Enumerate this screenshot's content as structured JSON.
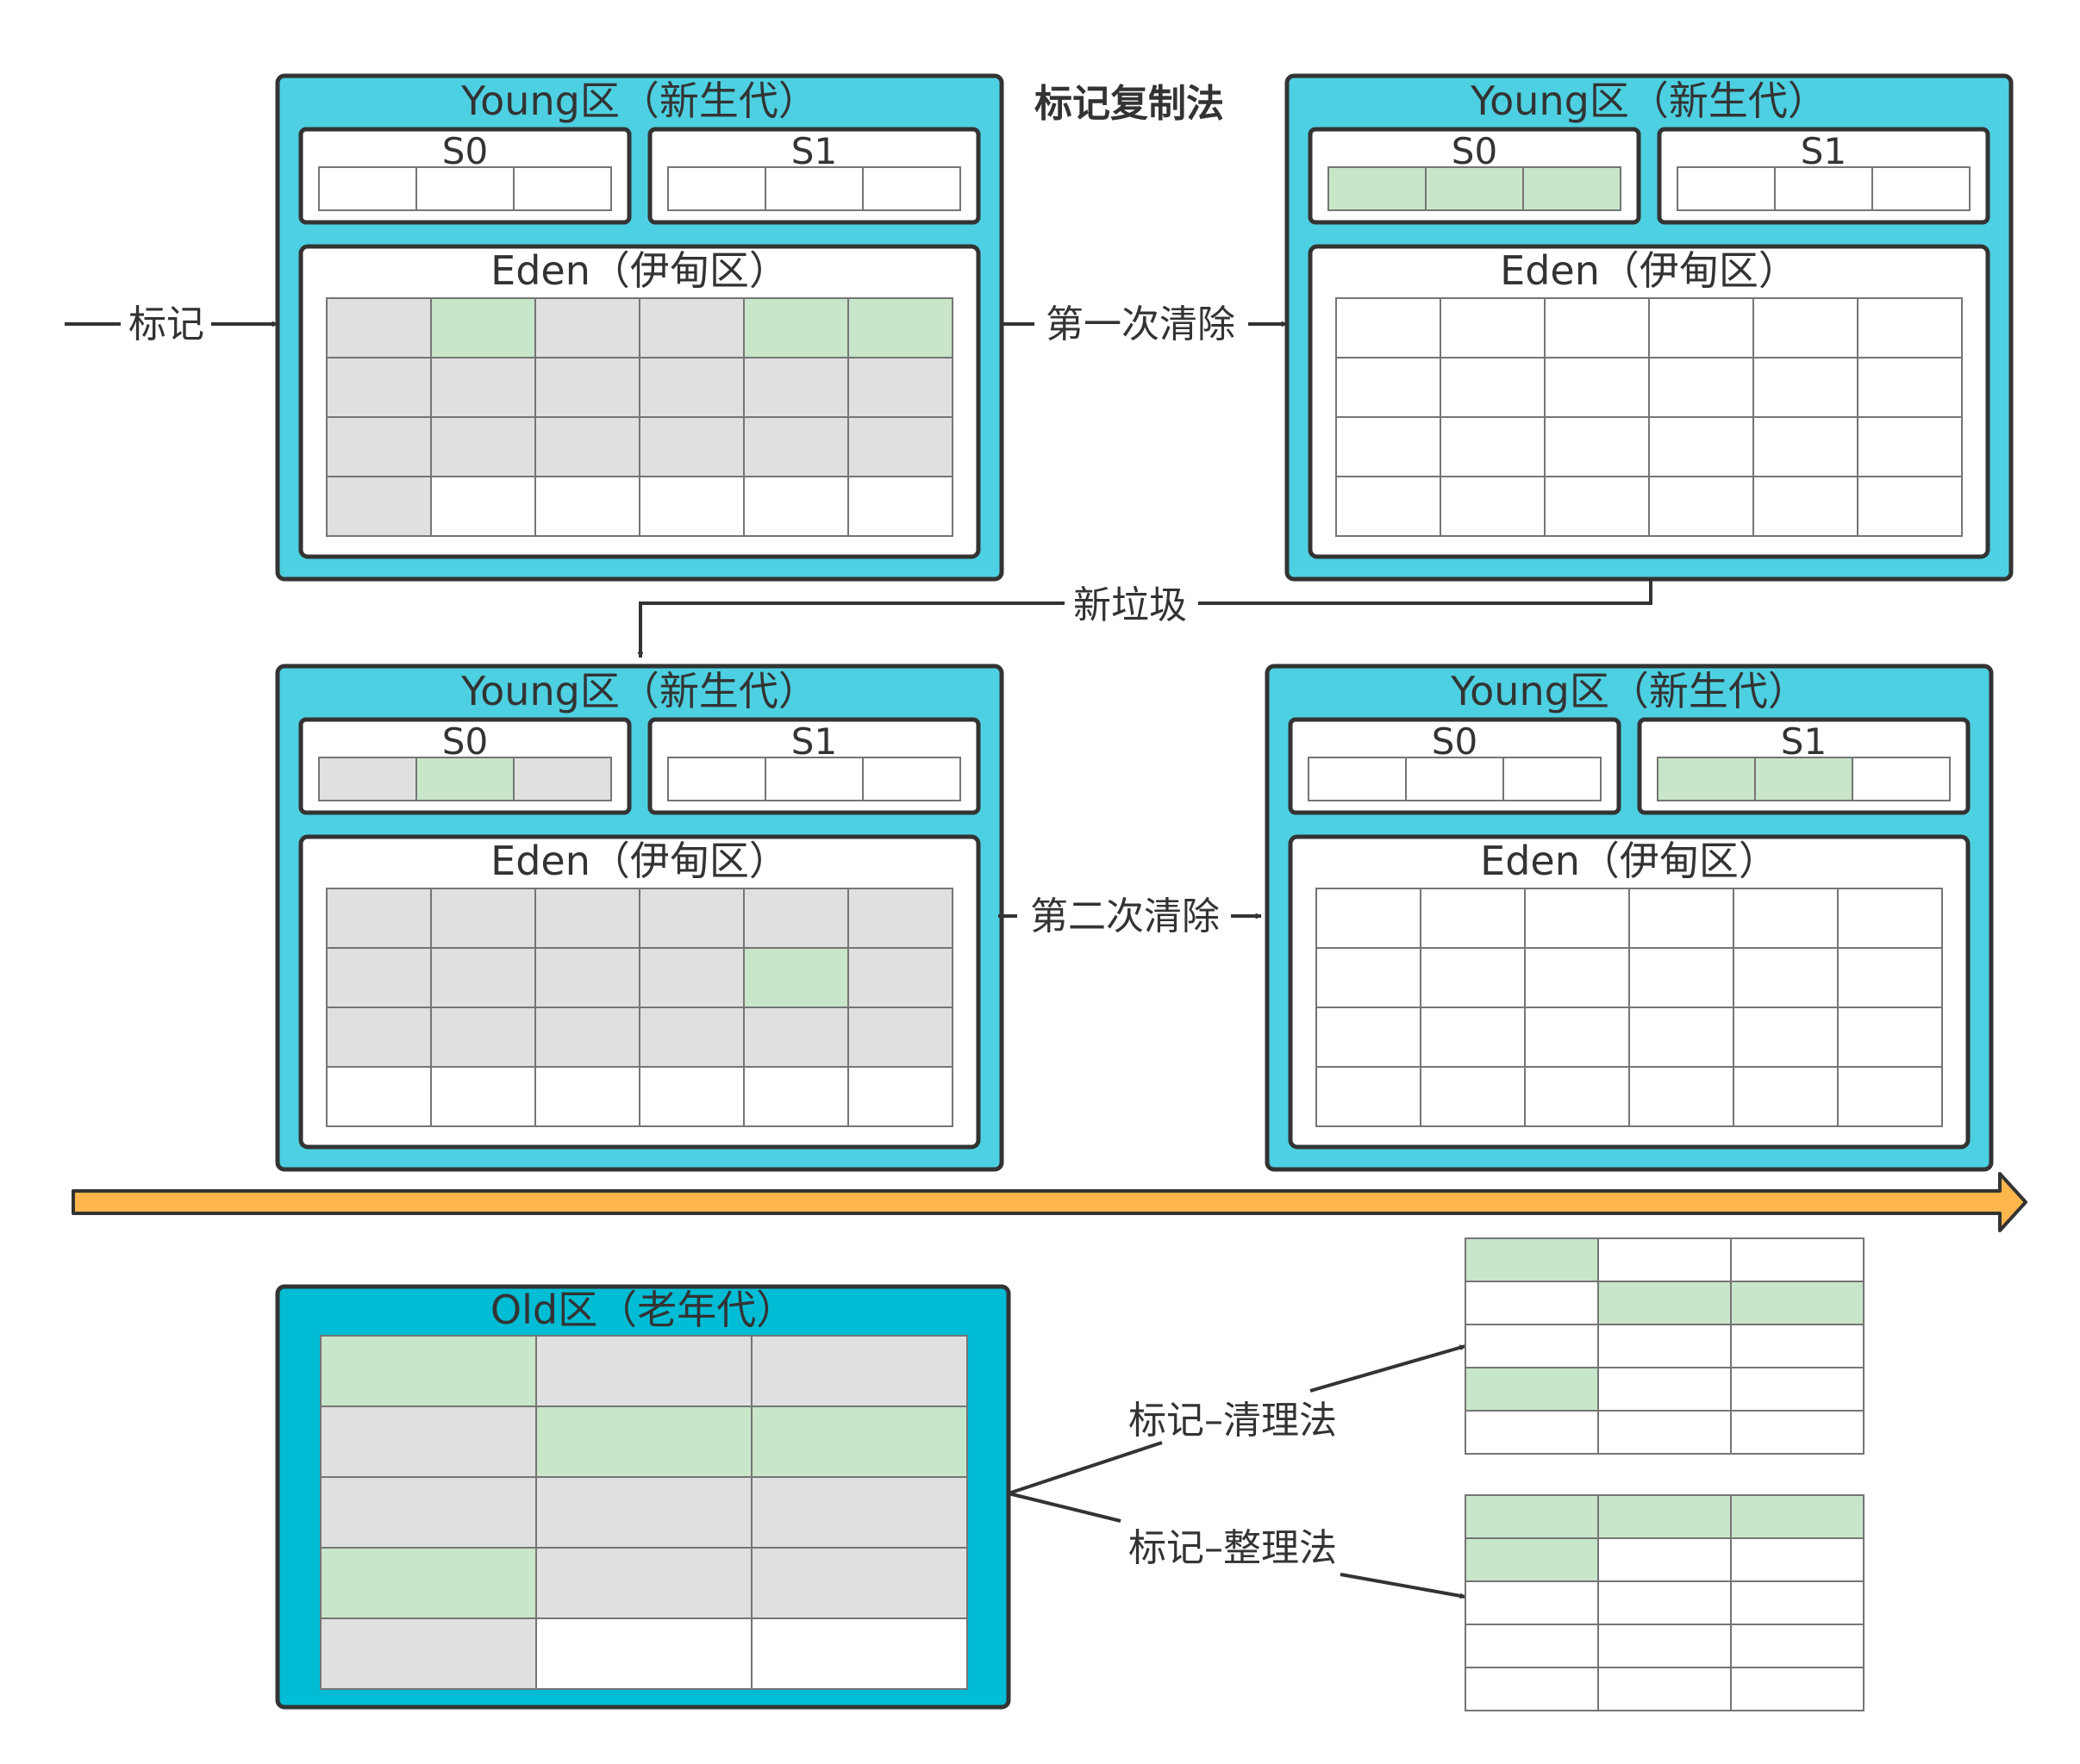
{
  "title": "标记复制法",
  "colors": {
    "young_fill": "#4dd0e1",
    "old_fill": "#00bcd4",
    "frame_border": "#333333",
    "live": "#c8e6c9",
    "garbage": "#e0e0e0",
    "free": "#ffffff",
    "cell_border": "#757575",
    "timeline": "#ffb74d"
  },
  "legend_cell_states": {
    "G": "garbage",
    "L": "live",
    "E": "free"
  },
  "young_panels": [
    {
      "title": "Young区（新生代）",
      "s0": {
        "label": "S0",
        "cells": "EEE"
      },
      "s1": {
        "label": "S1",
        "cells": "EEE"
      },
      "eden": {
        "label": "Eden（伊甸区）",
        "cells": [
          "GLGGLL",
          "GGGGGG",
          "GGGGGG",
          "GEEEEE"
        ]
      }
    },
    {
      "title": "Young区（新生代）",
      "s0": {
        "label": "S0",
        "cells": "LLL"
      },
      "s1": {
        "label": "S1",
        "cells": "EEE"
      },
      "eden": {
        "label": "Eden（伊甸区）",
        "cells": [
          "EEEEEE",
          "EEEEEE",
          "EEEEEE",
          "EEEEEE"
        ]
      }
    },
    {
      "title": "Young区（新生代）",
      "s0": {
        "label": "S0",
        "cells": "GLG"
      },
      "s1": {
        "label": "S1",
        "cells": "EEE"
      },
      "eden": {
        "label": "Eden（伊甸区）",
        "cells": [
          "GGGGGG",
          "GGGGLG",
          "GGGGGG",
          "EEEEEE"
        ]
      }
    },
    {
      "title": "Young区（新生代）",
      "s0": {
        "label": "S0",
        "cells": "EEE"
      },
      "s1": {
        "label": "S1",
        "cells": "LLE"
      },
      "eden": {
        "label": "Eden（伊甸区）",
        "cells": [
          "EEEEEE",
          "EEEEEE",
          "EEEEEE",
          "EEEEEE"
        ]
      }
    }
  ],
  "arrows": {
    "mark": "标记",
    "first_clean": "第一次清除",
    "new_garbage": "新垃圾",
    "second_clean": "第二次清除"
  },
  "old_panel": {
    "title": "Old区（老年代）",
    "cells": [
      "LGG",
      "GLL",
      "GGG",
      "LGG",
      "GEE"
    ]
  },
  "old_algorithms": [
    {
      "label": "标记–清理法",
      "cells": [
        "LEE",
        "ELL",
        "EEE",
        "LEE",
        "EEE"
      ]
    },
    {
      "label": "标记–整理法",
      "cells": [
        "LLL",
        "LEE",
        "EEE",
        "EEE",
        "EEE"
      ]
    }
  ]
}
